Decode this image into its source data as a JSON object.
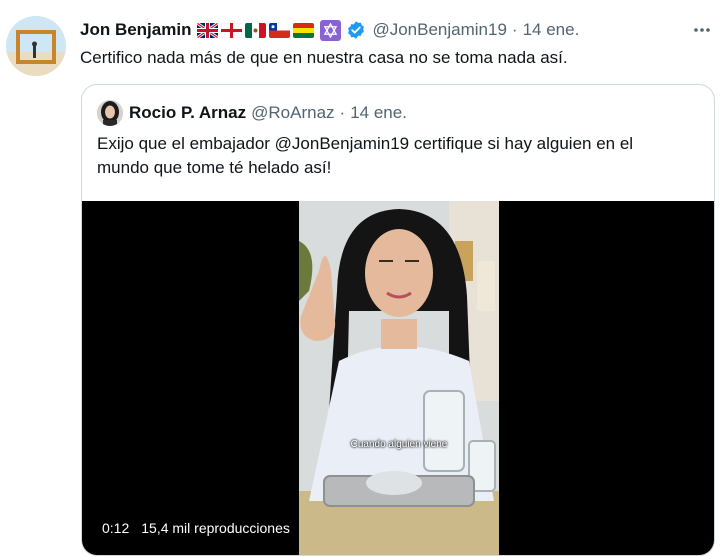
{
  "tweet": {
    "author_name": "Jon Benjamin",
    "handle": "@JonBenjamin19",
    "separator": "·",
    "date": "14 ene.",
    "flags": [
      "uk-flag",
      "england-flag",
      "mexico-flag",
      "chile-flag",
      "bolivia-flag"
    ],
    "text": "Certifico nada más de que en nuestra casa no se toma nada así."
  },
  "quote": {
    "author_name": "Rocio P. Arnaz",
    "handle": "@RoArnaz",
    "separator": "·",
    "date": "14 ene.",
    "text_lines": [
      "Exijo que el embajador @JonBenjamin19 certifique si hay alguien en el",
      "mundo que tome té helado así!"
    ],
    "video": {
      "caption": "Cuando alguien viene",
      "elapsed": "0:12",
      "views": "15,4 mil reproducciones"
    }
  },
  "colors": {
    "text": "#0f1419",
    "secondary": "#536471",
    "verified": "#1d9bf0",
    "border": "#cfd9de",
    "star_badge": "#8a63d2"
  }
}
